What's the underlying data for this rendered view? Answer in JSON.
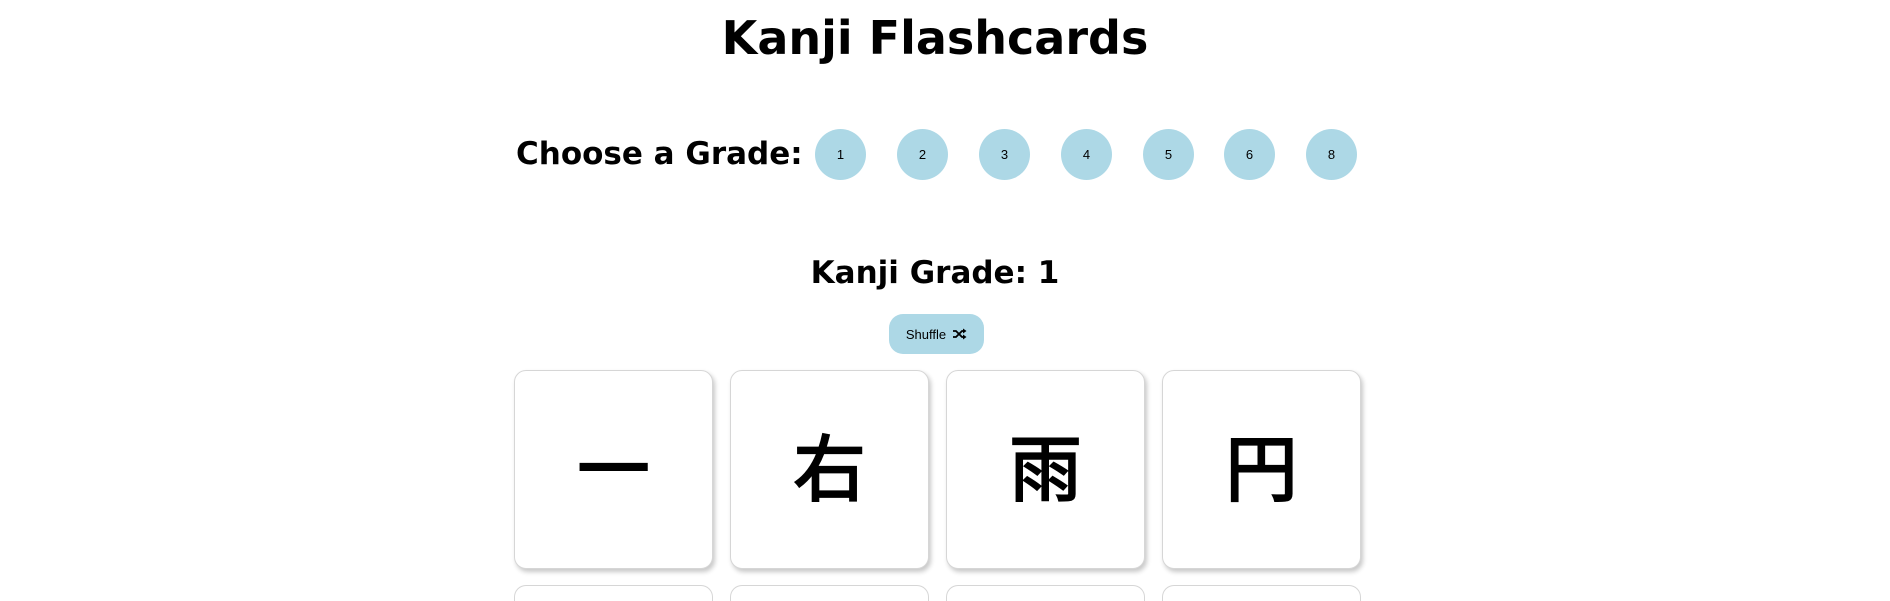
{
  "header": {
    "title": "Kanji Flashcards"
  },
  "grade_selector": {
    "label": "Choose a Grade:",
    "grades": [
      "1",
      "2",
      "3",
      "4",
      "5",
      "6",
      "8"
    ]
  },
  "current": {
    "heading": "Kanji Grade: 1",
    "shuffle_label": "Shuffle",
    "shuffle_icon": "shuffle-icon"
  },
  "cards": [
    {
      "kanji": "一"
    },
    {
      "kanji": "右"
    },
    {
      "kanji": "雨"
    },
    {
      "kanji": "円"
    }
  ],
  "colors": {
    "button_bg": "#add8e6",
    "card_border": "#d6d6d6"
  }
}
